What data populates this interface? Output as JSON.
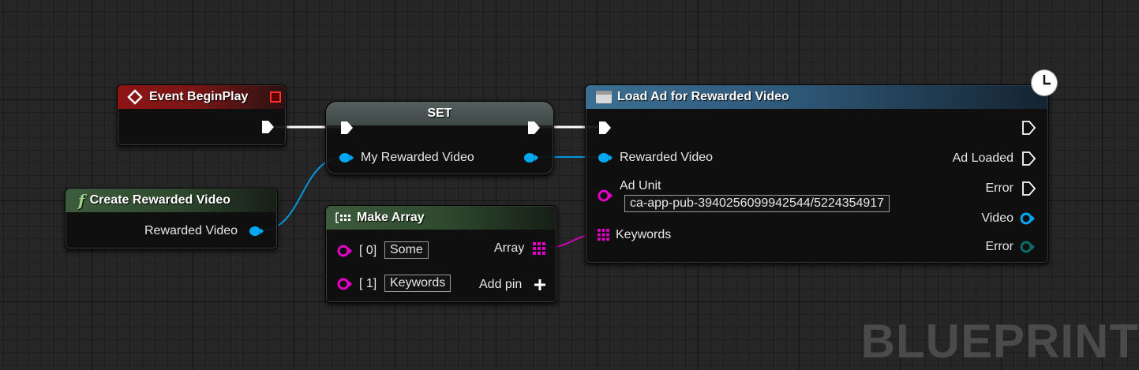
{
  "watermark": "BLUEPRINT",
  "nodes": {
    "event_begin_play": {
      "title": "Event BeginPlay"
    },
    "set": {
      "title": "SET",
      "var_label": "My Rewarded Video"
    },
    "create_rewarded_video": {
      "title": "Create Rewarded Video",
      "output_label": "Rewarded Video"
    },
    "make_array": {
      "title": "Make Array",
      "inputs": [
        {
          "index": "[ 0]",
          "value": "Some"
        },
        {
          "index": "[ 1]",
          "value": "Keywords"
        }
      ],
      "output_label": "Array",
      "add_pin_label": "Add pin"
    },
    "load_ad": {
      "title": "Load Ad for Rewarded Video",
      "inputs": {
        "rewarded_video": "Rewarded Video",
        "ad_unit": "Ad Unit",
        "ad_unit_value": "ca-app-pub-3940256099942544/5224354917",
        "keywords": "Keywords"
      },
      "outputs": {
        "ad_loaded": "Ad Loaded",
        "error_exec": "Error",
        "video": "Video",
        "error_obj": "Error"
      }
    }
  },
  "colors": {
    "exec": "#ffffff",
    "object_pin": "#00a8f4",
    "string_pin": "#e400c8",
    "wire_object": "#0096e0",
    "wire_string": "#d400b8",
    "error_pin": "#0e5e5e"
  }
}
